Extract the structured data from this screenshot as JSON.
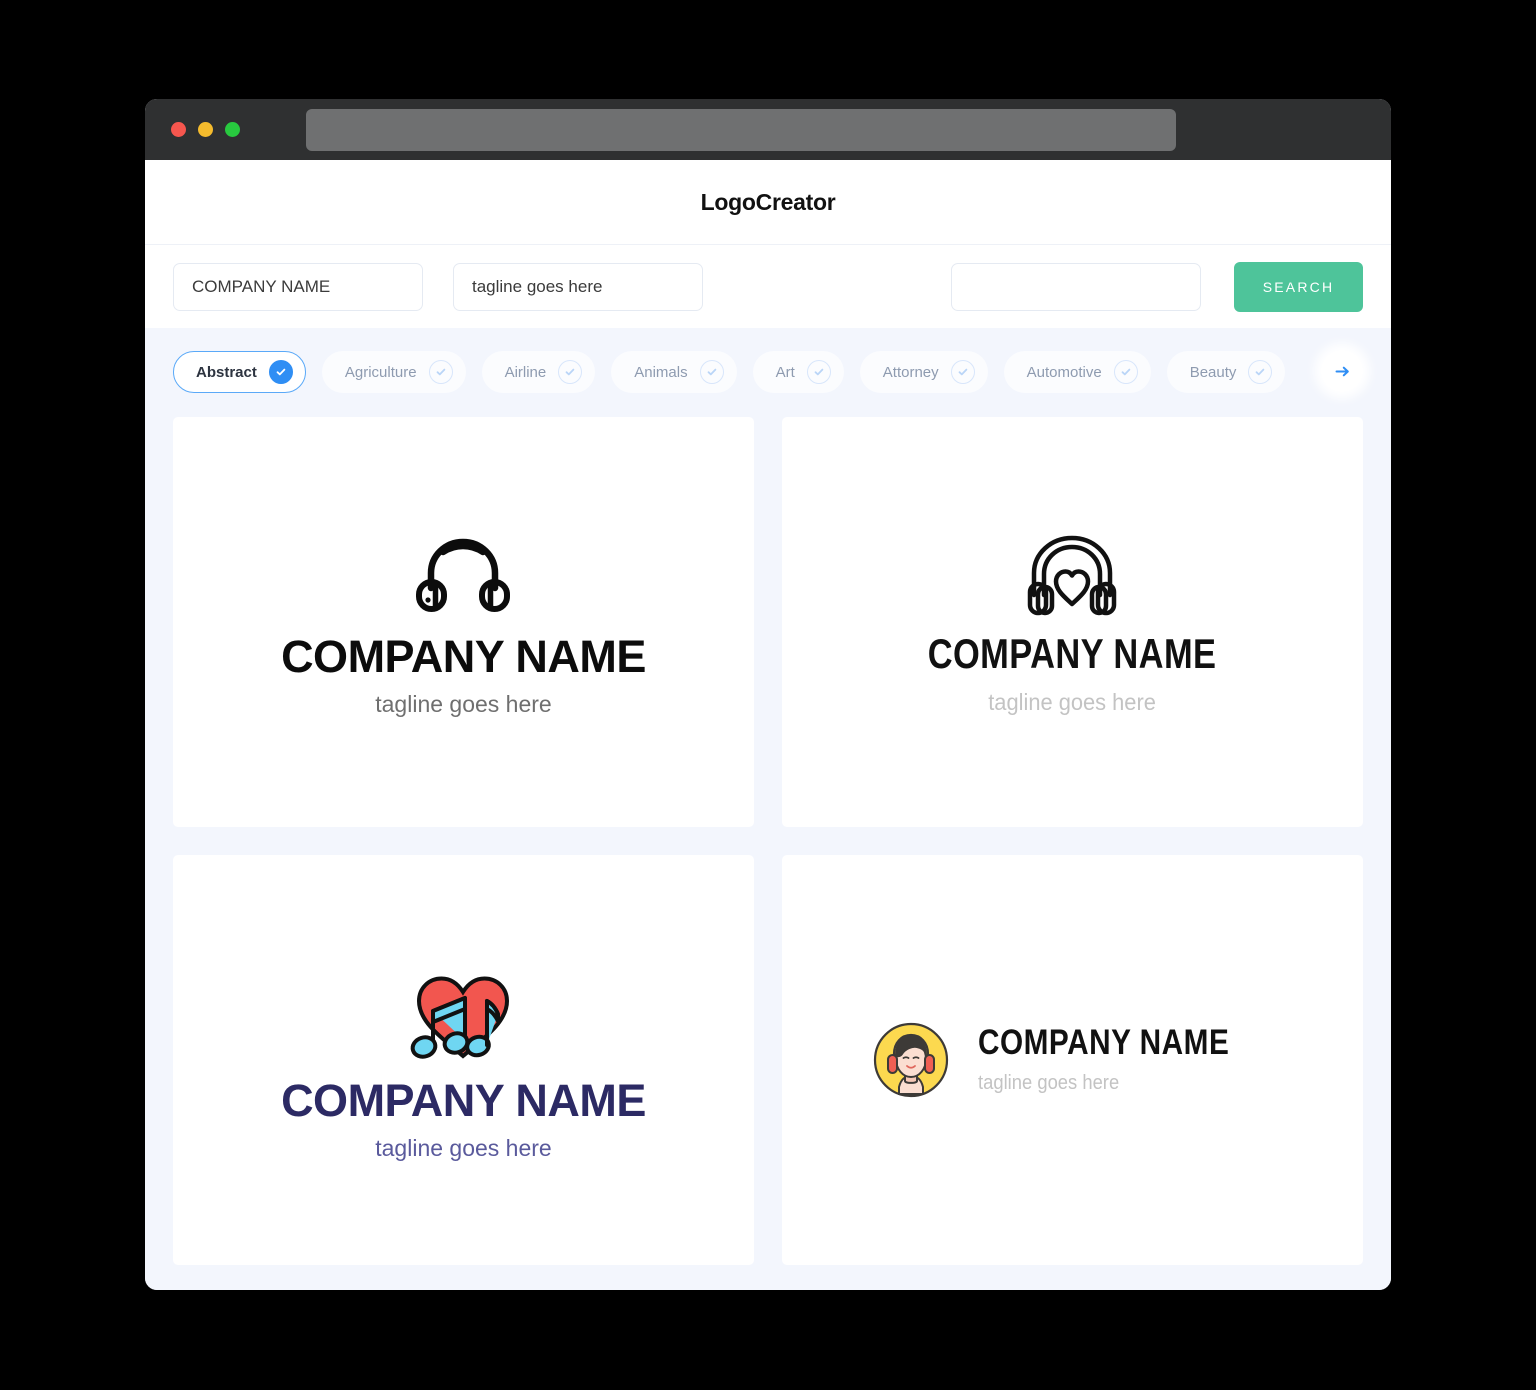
{
  "window": {
    "traffic_lights": [
      "close",
      "minimize",
      "maximize"
    ],
    "address_value": ""
  },
  "header": {
    "brand": "LogoCreator"
  },
  "search": {
    "company_value": "COMPANY NAME",
    "company_placeholder": "COMPANY NAME",
    "tagline_value": "tagline goes here",
    "tagline_placeholder": "tagline goes here",
    "keyword_value": "",
    "keyword_placeholder": "",
    "button_label": "SEARCH",
    "button_color": "#4ec49a"
  },
  "categories": {
    "active_index": 0,
    "accent": "#2f8ef4",
    "next_label": "→",
    "items": [
      {
        "label": "Abstract",
        "selected": true
      },
      {
        "label": "Agriculture",
        "selected": false
      },
      {
        "label": "Airline",
        "selected": false
      },
      {
        "label": "Animals",
        "selected": false
      },
      {
        "label": "Art",
        "selected": false
      },
      {
        "label": "Attorney",
        "selected": false
      },
      {
        "label": "Automotive",
        "selected": false
      },
      {
        "label": "Beauty",
        "selected": false
      }
    ]
  },
  "results": [
    {
      "icon": "headphones-icon",
      "name": "COMPANY NAME",
      "tagline": "tagline goes here",
      "name_color": "#0c0c0c",
      "tagline_color": "#6f6f6f",
      "layout": "stacked"
    },
    {
      "icon": "headphones-heart-icon",
      "name": "COMPANY NAME",
      "tagline": "tagline goes here",
      "name_color": "#111111",
      "tagline_color": "#c3c3c3",
      "layout": "stacked"
    },
    {
      "icon": "heart-music-notes-icon",
      "name": "COMPANY NAME",
      "tagline": "tagline goes here",
      "name_color": "#2c2a64",
      "tagline_color": "#5a5a9c",
      "layout": "stacked"
    },
    {
      "icon": "girl-headphones-avatar-icon",
      "name": "COMPANY NAME",
      "tagline": "tagline goes here",
      "name_color": "#111111",
      "tagline_color": "#c3c3c3",
      "layout": "horizontal"
    }
  ]
}
